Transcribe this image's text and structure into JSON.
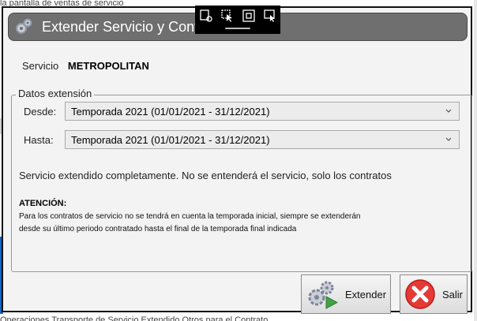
{
  "background": {
    "top_text": "la pantalla de ventas de servicio",
    "bottom_text": "Operaciones Transporte de Servicio Extendido Otros para el Contrato"
  },
  "dialog": {
    "title": "Extender Servicio y Contratos",
    "servicio_label": "Servicio",
    "servicio_value": "METROPOLITAN",
    "group_title": "Datos extensión",
    "desde_label": "Desde:",
    "desde_value": "Temporada 2021 (01/01/2021 - 31/12/2021)",
    "hasta_label": "Hasta:",
    "hasta_value": "Temporada 2021 (01/01/2021 - 31/12/2021)",
    "status_message": "Servicio extendido completamente. No se entenderá el servicio, solo los contratos",
    "atencion_title": "ATENCIÓN:",
    "atencion_line1": "Para los contratos de servicio no se tendrá en cuenta la temporada inicial, siempre se extenderán",
    "atencion_line2": "desde su último periodo contratado hasta el final de la temporada final indicada",
    "extender_button": "Extender",
    "salir_button": "Salir"
  },
  "icons": {
    "title_icon": "gears-icon",
    "extender_icon": "gears-play-icon",
    "salir_icon": "close-circle-icon"
  },
  "colors": {
    "titlebar": "#6f6f6f",
    "salir_red": "#e53935",
    "extender_green": "#43a047"
  }
}
